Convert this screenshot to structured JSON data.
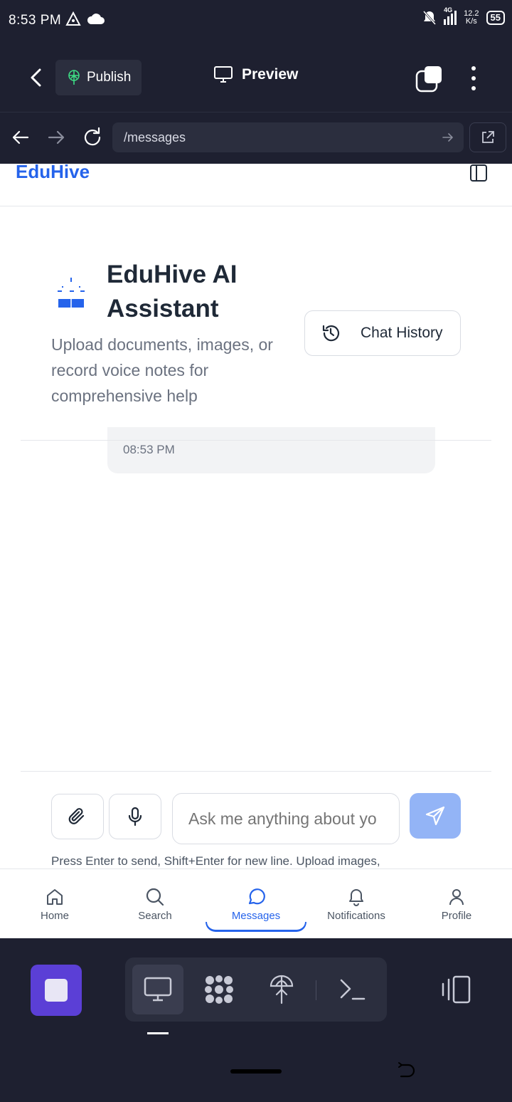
{
  "status_bar": {
    "time": "8:53 PM",
    "network": "4G",
    "speed_value": "12.2",
    "speed_unit": "K/s",
    "battery": "55"
  },
  "top_bar": {
    "publish_label": "Publish",
    "preview_label": "Preview"
  },
  "url_bar": {
    "url": "/messages"
  },
  "app": {
    "brand": "EduHive",
    "assistant_title": "EduHive AI Assistant",
    "assistant_subtitle": "Upload documents, images, or record voice notes for comprehensive help",
    "chat_history_label": "Chat History",
    "message_time": "08:53 PM",
    "input_placeholder": "Ask me anything about yo",
    "hint": "Press Enter to send, Shift+Enter for new line. Upload images,",
    "colors": {
      "accent": "#2563eb",
      "send_button": "#93b4f6"
    }
  },
  "bottom_nav": {
    "items": [
      {
        "label": "Home",
        "icon": "home-icon"
      },
      {
        "label": "Search",
        "icon": "search-icon"
      },
      {
        "label": "Messages",
        "icon": "message-icon",
        "active": true
      },
      {
        "label": "Notifications",
        "icon": "bell-icon"
      },
      {
        "label": "Profile",
        "icon": "user-icon"
      }
    ]
  },
  "ide_toolbar": {
    "tools": [
      "monitor-icon",
      "graph-icon",
      "deploy-icon",
      "terminal-icon"
    ],
    "stop_color": "#5b3fd6"
  }
}
